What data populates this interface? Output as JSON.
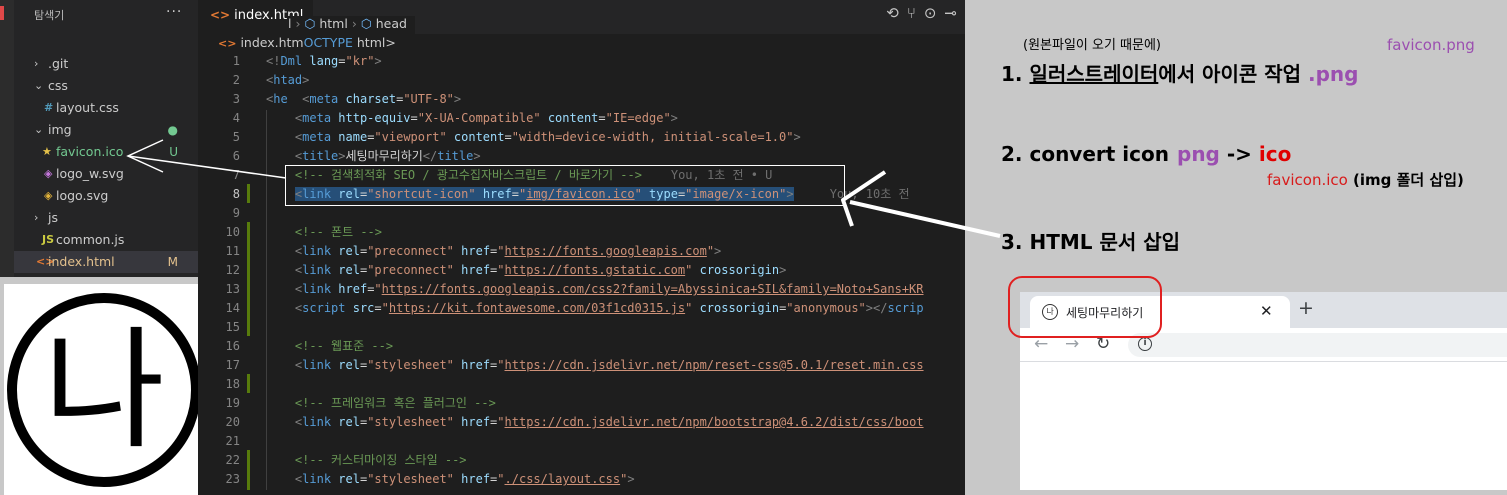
{
  "explorer": {
    "header": "탐색기",
    "more": "···",
    "items": [
      {
        "label": ".git",
        "twist": "›",
        "icon": "",
        "badge": ""
      },
      {
        "label": "css",
        "twist": "⌄",
        "icon": "",
        "badge": ""
      },
      {
        "label": "layout.css",
        "twist": "",
        "icon": "#",
        "badge": ""
      },
      {
        "label": "img",
        "twist": "⌄",
        "icon": "",
        "badge": "●"
      },
      {
        "label": "favicon.ico",
        "twist": "",
        "icon": "★",
        "badge": "U"
      },
      {
        "label": "logo_w.svg",
        "twist": "",
        "icon": "◈",
        "badge": ""
      },
      {
        "label": "logo.svg",
        "twist": "",
        "icon": "◈",
        "badge": ""
      },
      {
        "label": "js",
        "twist": "›",
        "icon": "",
        "badge": ""
      },
      {
        "label": "common.js",
        "twist": "",
        "icon": "JS",
        "badge": ""
      },
      {
        "label": "index.html",
        "twist": "",
        "icon": "<>",
        "badge": "M"
      }
    ]
  },
  "logo": {
    "glyph": "나"
  },
  "editor": {
    "tab_label": "index.html",
    "tab_icon": "<>",
    "tab_fragment": "l",
    "breadcrumb_html": "html",
    "breadcrumb_head": "head",
    "tab2_label": "index.htm",
    "tab2_doctype": "OCTYPE",
    "tab2_tag": "html>",
    "toolbar_icons": "⟲⑂⊙⊸",
    "lines": [
      {
        "n": "1",
        "html": "<span class='pu'>&lt;!</span><span class='tg'>Dml</span> <span class='at'>lang</span><span class='tx'>=</span><span class='st'>\"kr\"</span><span class='pu'>&gt;</span>"
      },
      {
        "n": "2",
        "html": "<span class='pu'>&lt;</span><span class='tg'>htad</span><span class='pu'>&gt;</span>"
      },
      {
        "n": "3",
        "html": "<span class='pu'>&lt;</span><span class='tg'>he</span>  <span class='pu'>&lt;</span><span class='tg'>meta</span> <span class='at'>charset</span><span class='tx'>=</span><span class='st'>\"UTF-8\"</span><span class='pu'>&gt;</span>"
      },
      {
        "n": "4",
        "html": "    <span class='pu'>&lt;</span><span class='tg'>meta</span> <span class='at'>http-equiv</span><span class='tx'>=</span><span class='st'>\"X-UA-Compatible\"</span> <span class='at'>content</span><span class='tx'>=</span><span class='st'>\"IE=edge\"</span><span class='pu'>&gt;</span>"
      },
      {
        "n": "5",
        "html": "    <span class='pu'>&lt;</span><span class='tg'>meta</span> <span class='at'>name</span><span class='tx'>=</span><span class='st'>\"viewport\"</span> <span class='at'>content</span><span class='tx'>=</span><span class='st'>\"width=device-width, initial-scale=1.0\"</span><span class='pu'>&gt;</span>"
      },
      {
        "n": "6",
        "html": "    <span class='pu'>&lt;</span><span class='tg'>title</span><span class='pu'>&gt;</span><span class='tx'>세팅마무리하기</span><span class='pu'>&lt;/</span><span class='tg'>title</span><span class='pu'>&gt;</span>"
      },
      {
        "n": "7",
        "html": "    <span class='cm'>&lt;!-- 검색최적화 SEO / 광고수집자바스크립트 / 바로가기 --&gt;</span>    <span class='ghost'>You, 1초 전 • U</span>"
      },
      {
        "n": "8",
        "html": "    <span class='sel'><span class='pu'>&lt;</span><span class='tg'>link</span> <span class='at'>rel</span><span class='tx'>=</span><span class='st'>\"shortcut-icon\"</span> <span class='at'>href</span><span class='tx'>=</span><span class='st'>\"<span class='lk'>img/favicon.ico</span>\"</span> <span class='at'>type</span><span class='tx'>=</span><span class='st'>\"image/x-icon\"</span><span class='pu'>&gt;</span></span>     <span class='ghost'>You, 10초 전</span>"
      },
      {
        "n": "9",
        "html": ""
      },
      {
        "n": "10",
        "html": "    <span class='cm'>&lt;!-- 폰트 --&gt;</span>"
      },
      {
        "n": "11",
        "html": "    <span class='pu'>&lt;</span><span class='tg'>link</span> <span class='at'>rel</span><span class='tx'>=</span><span class='st'>\"preconnect\"</span> <span class='at'>href</span><span class='tx'>=</span><span class='st'>\"<span class='lk'>https://fonts.googleapis.com</span>\"</span><span class='pu'>&gt;</span>"
      },
      {
        "n": "12",
        "html": "    <span class='pu'>&lt;</span><span class='tg'>link</span> <span class='at'>rel</span><span class='tx'>=</span><span class='st'>\"preconnect\"</span> <span class='at'>href</span><span class='tx'>=</span><span class='st'>\"<span class='lk'>https://fonts.gstatic.com</span>\"</span> <span class='at'>crossorigin</span><span class='pu'>&gt;</span>"
      },
      {
        "n": "13",
        "html": "    <span class='pu'>&lt;</span><span class='tg'>link</span> <span class='at'>href</span><span class='tx'>=</span><span class='st'>\"<span class='lk'>https://fonts.googleapis.com/css2?family=Abyssinica+SIL&amp;family=Noto+Sans+KR</span></span>"
      },
      {
        "n": "14",
        "html": "    <span class='pu'>&lt;</span><span class='tg'>script</span> <span class='at'>src</span><span class='tx'>=</span><span class='st'>\"<span class='lk'>https://kit.fontawesome.com/03f1cd0315.js</span>\"</span> <span class='at'>crossorigin</span><span class='tx'>=</span><span class='st'>\"anonymous\"</span><span class='pu'>&gt;&lt;/</span><span class='tg'>scrip</span>"
      },
      {
        "n": "15",
        "html": ""
      },
      {
        "n": "16",
        "html": "    <span class='cm'>&lt;!-- 웹표준 --&gt;</span>"
      },
      {
        "n": "17",
        "html": "    <span class='pu'>&lt;</span><span class='tg'>link</span> <span class='at'>rel</span><span class='tx'>=</span><span class='st'>\"stylesheet\"</span> <span class='at'>href</span><span class='tx'>=</span><span class='st'>\"<span class='lk'>https://cdn.jsdelivr.net/npm/reset-css@5.0.1/reset.min.css</span></span>"
      },
      {
        "n": "18",
        "html": ""
      },
      {
        "n": "19",
        "html": "    <span class='cm'>&lt;!-- 프레임워크 혹은 플러그인 --&gt;</span>"
      },
      {
        "n": "20",
        "html": "    <span class='pu'>&lt;</span><span class='tg'>link</span> <span class='at'>rel</span><span class='tx'>=</span><span class='st'>\"stylesheet\"</span> <span class='at'>href</span><span class='tx'>=</span><span class='st'>\"<span class='lk'>https://cdn.jsdelivr.net/npm/bootstrap@4.6.2/dist/css/boot</span></span>"
      },
      {
        "n": "21",
        "html": ""
      },
      {
        "n": "22",
        "html": "    <span class='cm'>&lt;!-- 커스터마이징 스타일 --&gt;</span>"
      },
      {
        "n": "23",
        "html": "    <span class='pu'>&lt;</span><span class='tg'>link</span> <span class='at'>rel</span><span class='tx'>=</span><span class='st'>\"stylesheet\"</span> <span class='at'>href</span><span class='tx'>=</span><span class='st'>\"<span class='lk'>./css/layout.css</span>\"</span><span class='pu'>&gt;</span>"
      }
    ]
  },
  "notes": {
    "small_note": "(원본파일이 오기 때문에)",
    "favicon_png": "favicon.png",
    "step1_num": "1. ",
    "step1_ul": "일러스트레이터",
    "step1_rest": "에서 아이콘 작업 ",
    "step1_ext": ".png",
    "step2_text": "2. convert icon",
    "step2_png": "png",
    "step2_arrow": " -> ",
    "step2_ico": "ico",
    "favicon_ico": "favicon.ico",
    "favicon_ico_note": " (img 폴더 삽입)",
    "step3": "3. HTML 문서  삽입"
  },
  "browser": {
    "tab_title": "세팅마무리하기",
    "tab_favicon": "나",
    "close": "✕",
    "new_tab": "+",
    "back": "←",
    "forward": "→",
    "reload": "↻",
    "info": "i"
  },
  "colors": {
    "purple": "#9b4fb0",
    "red": "#e00000",
    "editor_bg": "#1e1e1e",
    "sidebar_bg": "#252526"
  }
}
